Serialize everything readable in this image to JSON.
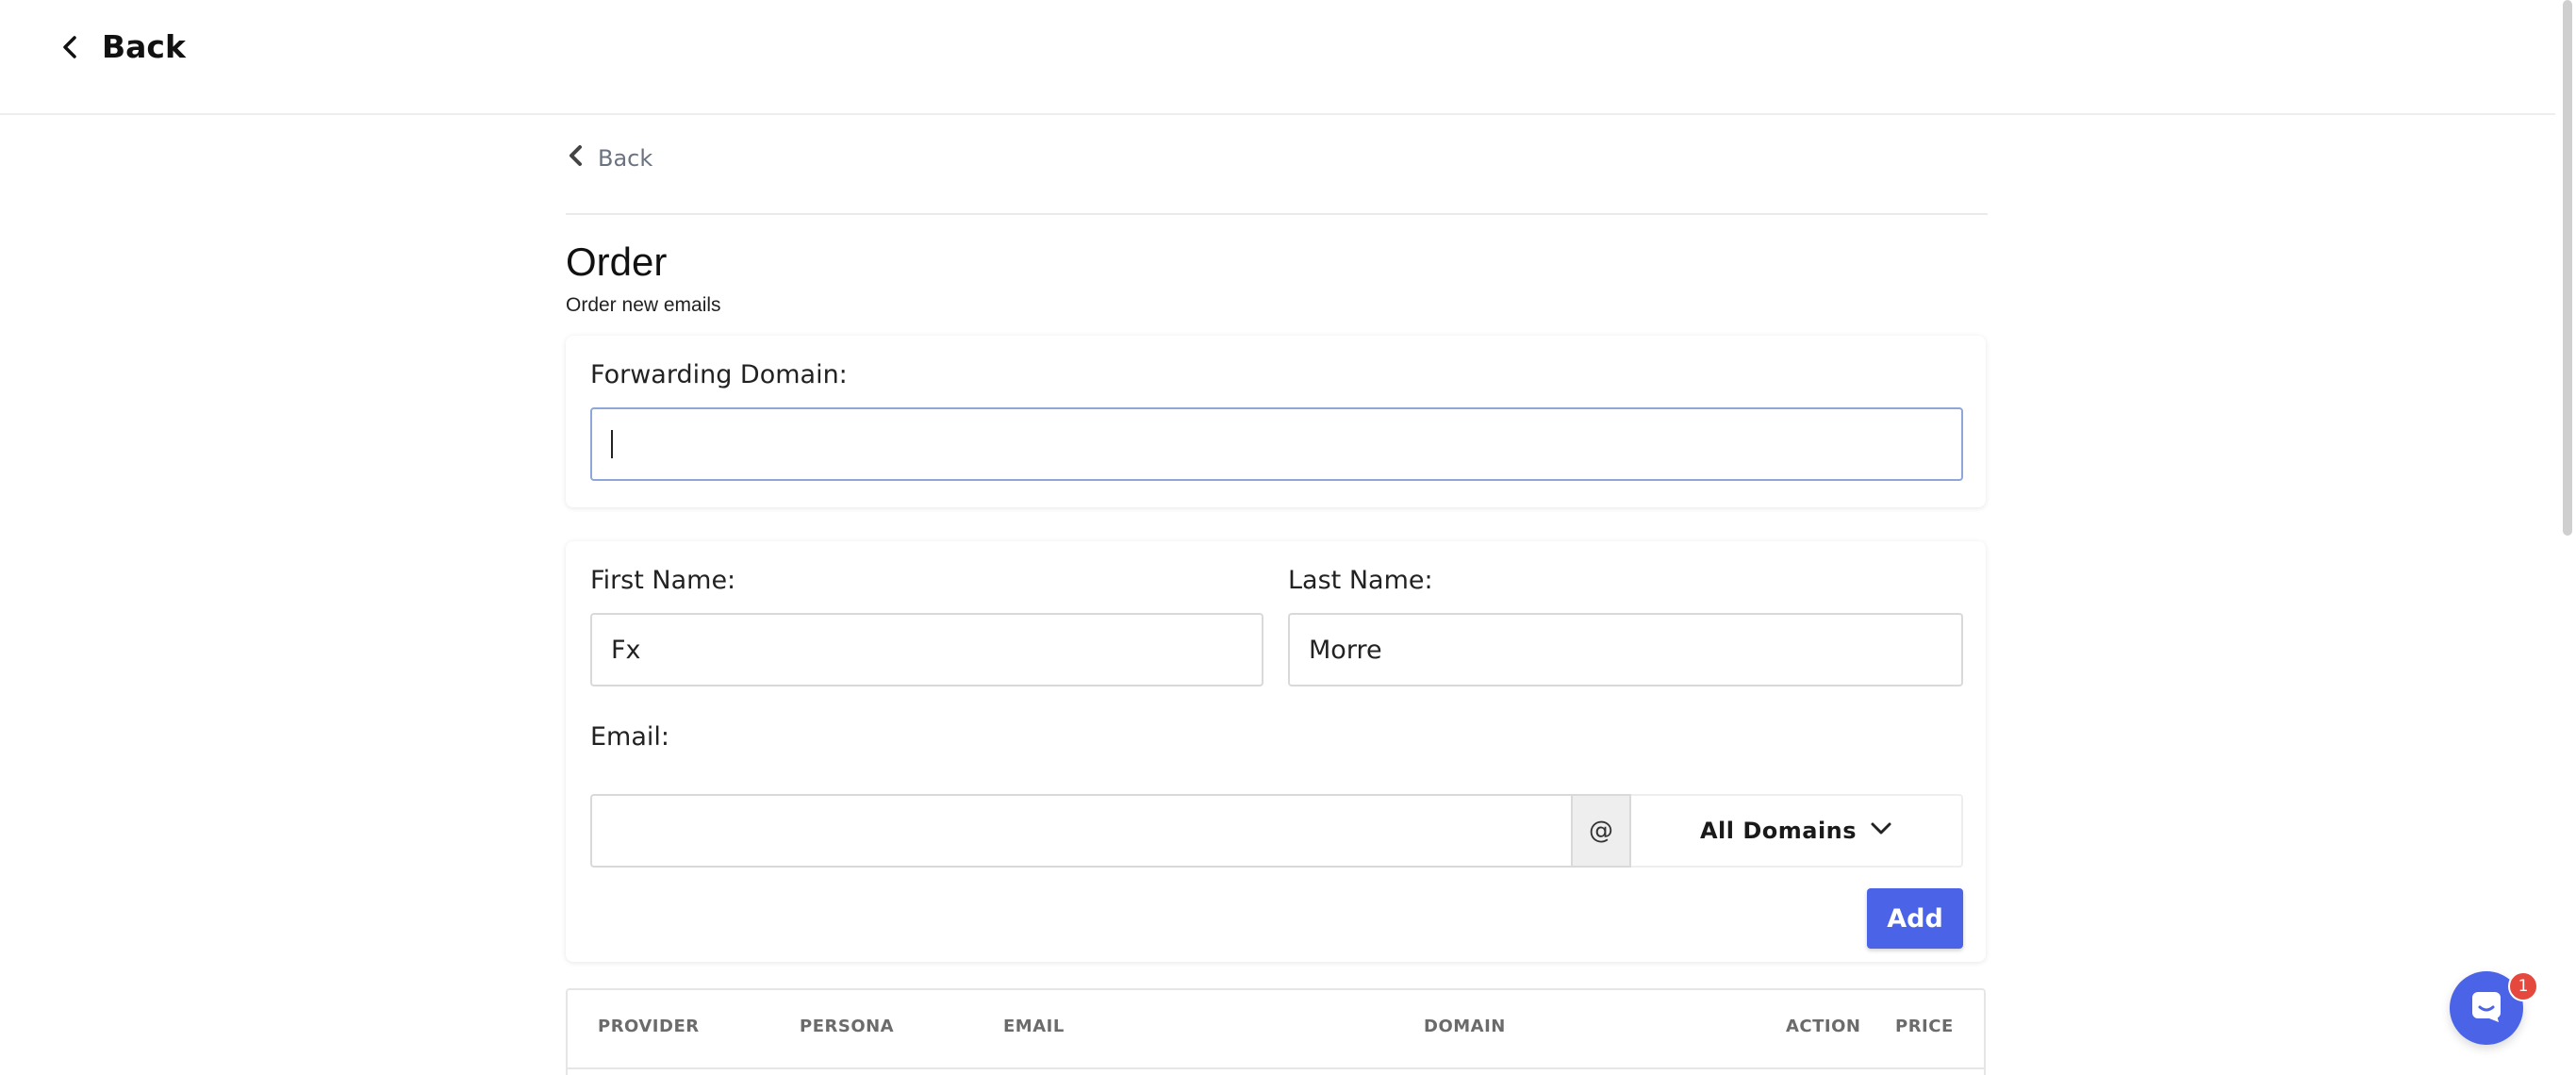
{
  "topbar": {
    "back_label": "Back"
  },
  "subnav": {
    "back_label": "Back"
  },
  "page": {
    "title": "Order",
    "subtitle": "Order new emails"
  },
  "forwarding": {
    "label": "Forwarding Domain:",
    "value": ""
  },
  "form": {
    "first_name_label": "First Name:",
    "first_name_value": "Fx",
    "last_name_label": "Last Name:",
    "last_name_value": "Morre",
    "email_label": "Email:",
    "email_value": "",
    "at_symbol": "@",
    "domain_select": "All Domains",
    "add_label": "Add"
  },
  "table": {
    "headers": [
      "PROVIDER",
      "PERSONA",
      "EMAIL",
      "DOMAIN",
      "ACTION",
      "PRICE"
    ]
  },
  "chat": {
    "badge_count": "1"
  },
  "colors": {
    "accent": "#4a63e7",
    "badge": "#e5483d",
    "focus_border": "#8fa6d8"
  },
  "icons": [
    "chevron-left-icon",
    "chevron-down-icon",
    "chat-icon"
  ]
}
